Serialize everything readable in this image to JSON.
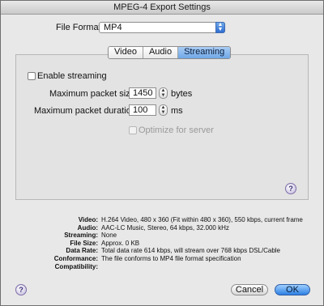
{
  "window": {
    "title": "MPEG-4 Export Settings"
  },
  "file_format": {
    "label": "File Format:",
    "value": "MP4"
  },
  "tabs": [
    {
      "label": "Video",
      "active": false
    },
    {
      "label": "Audio",
      "active": false
    },
    {
      "label": "Streaming",
      "active": true
    }
  ],
  "streaming": {
    "enable_label": "Enable streaming",
    "enable_checked": false,
    "max_packet_size": {
      "label": "Maximum packet size:",
      "value": "1450",
      "unit": "bytes"
    },
    "max_packet_duration": {
      "label": "Maximum packet duration:",
      "value": "100",
      "unit": "ms"
    },
    "optimize_label": "Optimize for server",
    "optimize_enabled": false
  },
  "summary": [
    {
      "key": "Video:",
      "value": "H.264 Video, 480 x 360 (Fit within 480 x 360), 550 kbps, current frame"
    },
    {
      "key": "Audio:",
      "value": "AAC-LC Music, Stereo, 64 kbps, 32.000 kHz"
    },
    {
      "key": "Streaming:",
      "value": "None"
    },
    {
      "key": "File Size:",
      "value": "Approx. 0 KB"
    },
    {
      "key": "Data Rate:",
      "value": "Total data rate 614 kbps, will stream over 768 kbps DSL/Cable"
    },
    {
      "key": "Conformance:",
      "value": "The file conforms to MP4 file format specification"
    },
    {
      "key": "Compatibility:",
      "value": ""
    }
  ],
  "buttons": {
    "cancel": "Cancel",
    "ok": "OK"
  },
  "icons": {
    "help": "help-icon"
  },
  "colors": {
    "accent": "#2d7fe3",
    "tab_active": "#6fa8e8"
  }
}
